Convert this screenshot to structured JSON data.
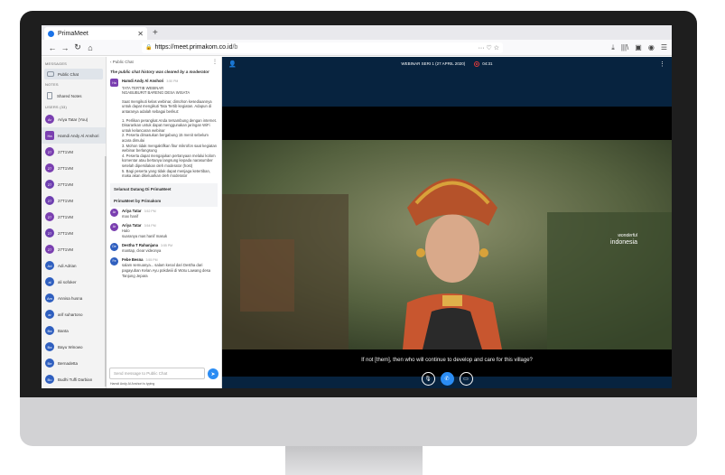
{
  "browser": {
    "tab_title": "PrimaMeet",
    "tab_close": "✕",
    "new_tab": "+",
    "url_domain": "https://meet.primakom.co.id",
    "url_rest": "/b",
    "nav_icons": [
      "back-icon",
      "forward-icon",
      "reload-icon",
      "home-icon"
    ],
    "right_icons": [
      "more-icon",
      "pocket-icon",
      "star-icon",
      "download-icon",
      "library-icon",
      "sidebar-icon",
      "account-icon",
      "menu-icon"
    ]
  },
  "sidebar": {
    "messages_label": "MESSAGES",
    "public_chat": "Public Chat",
    "notes_label": "NOTES",
    "shared_notes": "Shared Notes",
    "users_label": "USERS (33)",
    "users": [
      {
        "initials": "Ar",
        "name": "Ariya Tatar (You)",
        "color": "#7a3fb0",
        "square": false
      },
      {
        "initials": "Ha",
        "name": "Hamdi Andy Al Anshori",
        "color": "#7a3fb0",
        "square": true
      },
      {
        "initials": "27",
        "name": "27T1VM",
        "color": "#7a3fb0",
        "square": false
      },
      {
        "initials": "27",
        "name": "27T1VM",
        "color": "#7a3fb0",
        "square": false
      },
      {
        "initials": "27",
        "name": "27T1VM",
        "color": "#6e3fb0",
        "square": false
      },
      {
        "initials": "27",
        "name": "27T1VM",
        "color": "#6e3fb0",
        "square": false
      },
      {
        "initials": "27",
        "name": "27T1VM",
        "color": "#7a3fb0",
        "square": false
      },
      {
        "initials": "27",
        "name": "27T1VM",
        "color": "#6e3fb0",
        "square": false
      },
      {
        "initials": "27",
        "name": "27T1VM",
        "color": "#7a3fb0",
        "square": false
      },
      {
        "initials": "Ad",
        "name": "Adi Adrian",
        "color": "#2f5fbf",
        "square": false
      },
      {
        "initials": "al",
        "name": "ali sofoker",
        "color": "#2f5fbf",
        "square": false
      },
      {
        "initials": "Am",
        "name": "Annisa husna",
        "color": "#2f5fbf",
        "square": false
      },
      {
        "initials": "ar",
        "name": "arif suhartono",
        "color": "#2f5fbf",
        "square": false
      },
      {
        "initials": "Ba",
        "name": "Banta",
        "color": "#2f5fbf",
        "square": false
      },
      {
        "initials": "Ba",
        "name": "Bayu Winowo",
        "color": "#2f5fbf",
        "square": false
      },
      {
        "initials": "Be",
        "name": "Bernadetta",
        "color": "#2f5fbf",
        "square": false
      },
      {
        "initials": "Bu",
        "name": "Budhi Tuffi Darbian",
        "color": "#2f5fbf",
        "square": false
      }
    ]
  },
  "chat": {
    "back_label": "‹ Public Chat",
    "cleared_notice": "The public chat history was cleared by a moderator",
    "welcome": {
      "initials": "Ha",
      "name": "Hamdi Andy Al Anshori",
      "time": "3:50 PM",
      "lines": "TATA TERTIB WEBINAR\nNGABUBURIT BARENG DESA WISATA",
      "para1": "Saat mengikuti kelas webinar, dimohon kesediaannya untuk dapat mengikuti Tata Tertib kegiatan. Adapun di antaranya adalah sebagai berikut:",
      "para2": "1. Perlikan perangkat Anda tersambung dengan internet. Disarankan untuk dapat menggunakan jaringan WiFi untuk kelancaran webinar\n2. Peserta dimasukan bergabung 15 menit sebelum acara dimulai\n3. Mohon tidak mengaktifkan fitur mikrofon saat kegiatan webinar berlangsung\n4. Peserta dapat mengajukan pertanyaan melalui kolom komentar atau bertanya langsung kepada narasumber setelah dipersilakan oleh moderator (host)\n5. Bagi peserta yang tidak dapat menjaga ketertiban, maka akan dikeluarkan oleh moderator"
    },
    "system1": "Selamat Datang Di PrimaMeet",
    "system2": "PrimaMeet by Primakom",
    "messages": [
      {
        "initials": "Ar",
        "name": "Ariya Tatar",
        "time": "3:52 PM",
        "text": "max hanif",
        "color": "#7a3fb0"
      },
      {
        "initials": "Ar",
        "name": "Ariya Tatar",
        "time": "3:54 PM",
        "text": "Halo\nsuaranya mas hanif masuk",
        "color": "#7a3fb0"
      },
      {
        "initials": "De",
        "name": "Destha T Rahanjana",
        "time": "3:55 PM",
        "text": "mantap, clear videonya",
        "color": "#2f5fbf"
      },
      {
        "initials": "Fe",
        "name": "Febe Besna",
        "time": "3:55 PM",
        "text": "salam semuanya... salam kenal dari Destha dari pagayuban Kelan Ayu pokdwiii di Wotu Lawang desa Tanjung Jepara",
        "color": "#2f5fbf"
      }
    ],
    "input_placeholder": "Send message to Public Chat",
    "typing": "Hamdi Andy Al Anshori is typing"
  },
  "stage": {
    "title": "WEBINAR SERI 1 (27 APRIL 2020)",
    "timer": "04:31",
    "subtitle": "If not [them], then who will continue to develop and care for this village?",
    "watermark_top": "wonderful",
    "watermark_bottom": "indonesia",
    "controls": [
      "microphone-icon",
      "phone-icon",
      "screen-share-icon"
    ]
  }
}
